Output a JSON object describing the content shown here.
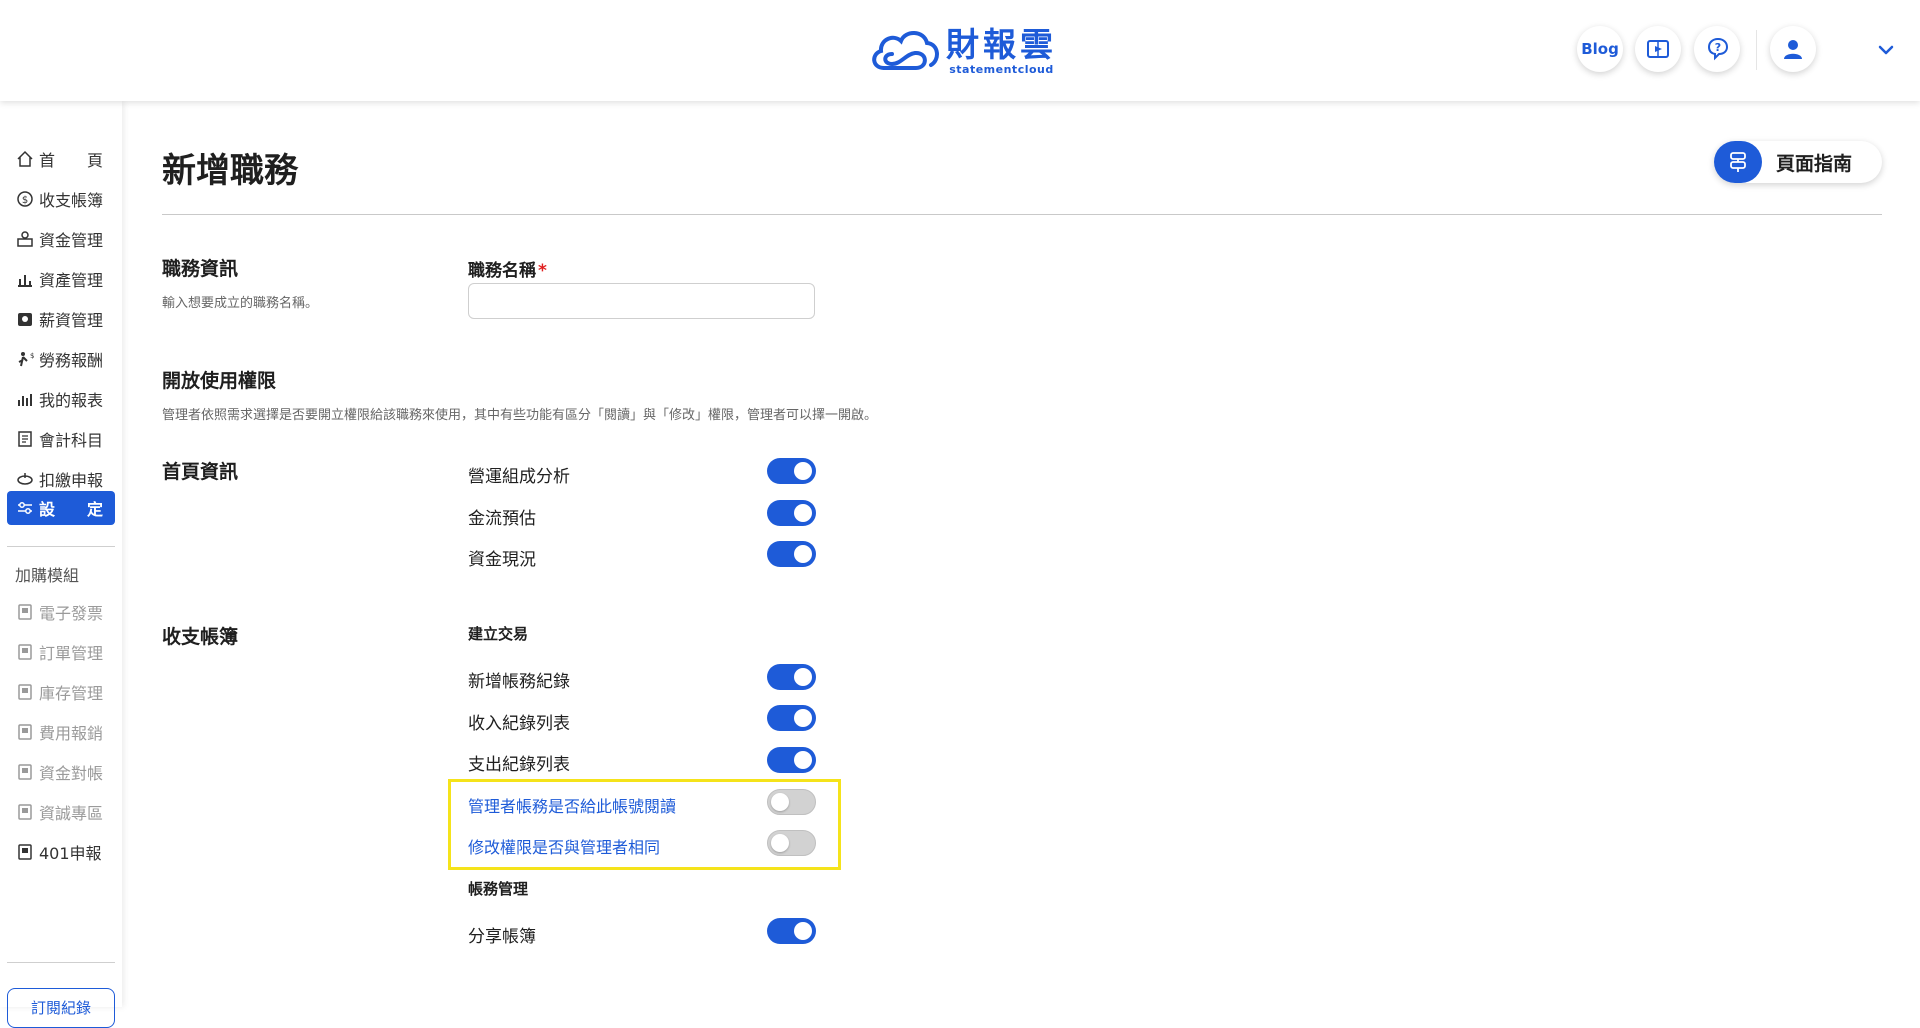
{
  "header": {
    "logo_cn": "財報雲",
    "logo_en": "statementcloud",
    "blog_label": "Blog",
    "icons": [
      "play-book-icon",
      "help-chat-icon",
      "user-avatar-icon",
      "chevron-down-icon"
    ]
  },
  "sidebar": {
    "items": [
      {
        "label": "首　　頁",
        "icon": "home-icon"
      },
      {
        "label": "收支帳簿",
        "icon": "coin-icon"
      },
      {
        "label": "資金管理",
        "icon": "fund-icon"
      },
      {
        "label": "資產管理",
        "icon": "assets-icon"
      },
      {
        "label": "薪資管理",
        "icon": "salary-icon"
      },
      {
        "label": "勞務報酬",
        "icon": "labor-icon"
      },
      {
        "label": "我的報表",
        "icon": "report-icon"
      },
      {
        "label": "會計科目",
        "icon": "ledger-icon"
      },
      {
        "label": "扣繳申報",
        "icon": "tax-icon"
      },
      {
        "label": "設　　定",
        "icon": "settings-icon"
      }
    ],
    "addon_heading": "加購模組",
    "addons": [
      {
        "label": "電子發票",
        "enabled": false
      },
      {
        "label": "訂單管理",
        "enabled": false
      },
      {
        "label": "庫存管理",
        "enabled": false
      },
      {
        "label": "費用報銷",
        "enabled": false
      },
      {
        "label": "資金對帳",
        "enabled": false
      },
      {
        "label": "資誠專區",
        "enabled": false
      },
      {
        "label": "401申報",
        "enabled": true
      }
    ],
    "subscription_label": "訂閱紀錄"
  },
  "main": {
    "title": "新增職務",
    "guide_label": "頁面指南",
    "job_info": {
      "title": "職務資訊",
      "desc": "輸入想要成立的職務名稱。",
      "field_label": "職務名稱",
      "required_mark": "*",
      "value": "",
      "placeholder": ""
    },
    "permissions": {
      "title": "開放使用權限",
      "desc": "管理者依照需求選擇是否要開立權限給該職務來使用，其中有些功能有區分「閱讀」與「修改」權限，管理者可以擇一開啟。"
    },
    "home_info": {
      "title": "首頁資訊",
      "toggles": [
        {
          "label": "營運組成分析",
          "on": true
        },
        {
          "label": "金流預估",
          "on": true
        },
        {
          "label": "資金現況",
          "on": true
        }
      ]
    },
    "ledger": {
      "title": "收支帳簿",
      "sub1": "建立交易",
      "toggles1": [
        {
          "label": "新增帳務紀錄",
          "on": true
        },
        {
          "label": "收入紀錄列表",
          "on": true
        },
        {
          "label": "支出紀錄列表",
          "on": true
        },
        {
          "label": "管理者帳務是否給此帳號閱讀",
          "on": false
        },
        {
          "label": "修改權限是否與管理者相同",
          "on": false
        }
      ],
      "sub2": "帳務管理",
      "toggles2": [
        {
          "label": "分享帳簿",
          "on": true
        }
      ]
    }
  }
}
